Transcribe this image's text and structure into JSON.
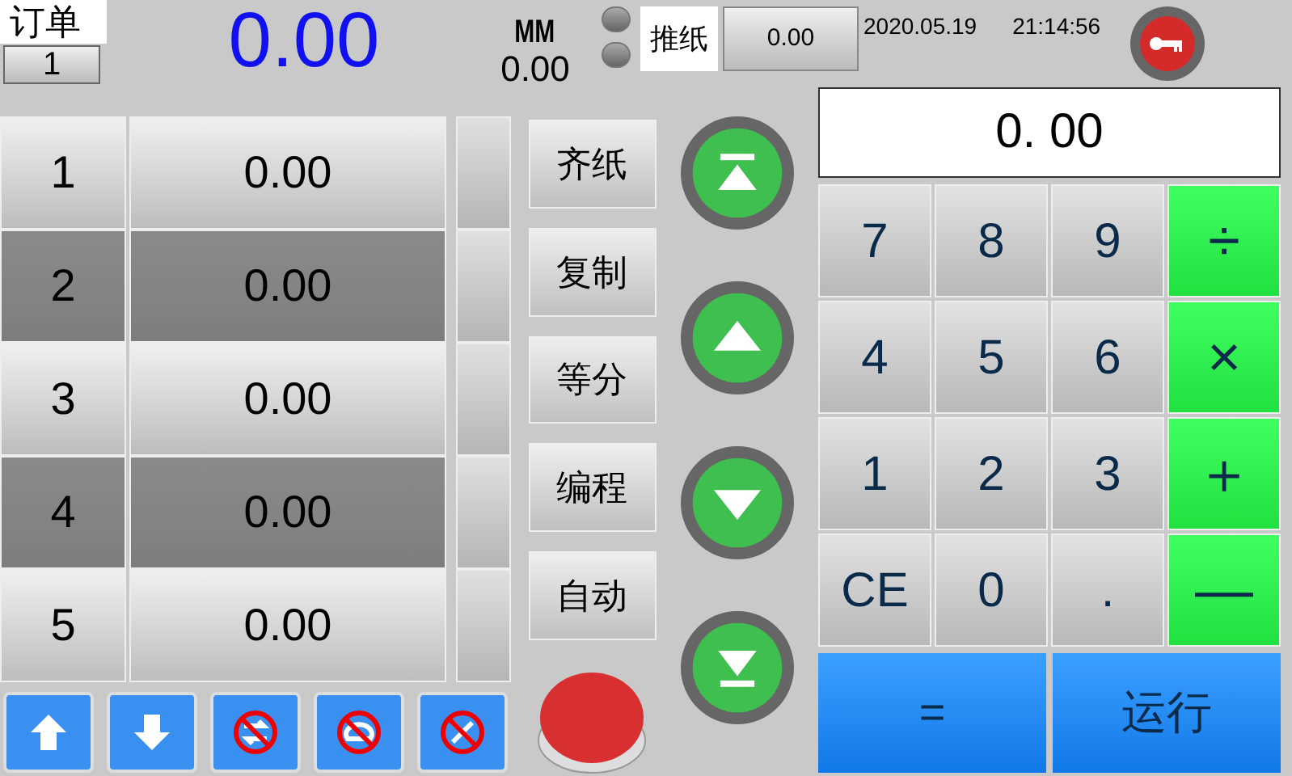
{
  "order": {
    "label": "订单",
    "value": "1"
  },
  "main_value": "0.00",
  "unit": "MM",
  "sub_value": "0.00",
  "lamps": [
    {
      "on": false
    },
    {
      "on": false
    }
  ],
  "push": {
    "label": "推纸",
    "value": "0.00"
  },
  "date": "2020.05.19",
  "time": "21:14:56",
  "rows": [
    {
      "index": "1",
      "value": "0.00",
      "selected": false
    },
    {
      "index": "2",
      "value": "0.00",
      "selected": true
    },
    {
      "index": "3",
      "value": "0.00",
      "selected": false
    },
    {
      "index": "4",
      "value": "0.00",
      "selected": true
    },
    {
      "index": "5",
      "value": "0.00",
      "selected": false
    }
  ],
  "function_buttons": [
    "齐纸",
    "复制",
    "等分",
    "编程",
    "自动"
  ],
  "jog_buttons": [
    {
      "kind": "top"
    },
    {
      "kind": "up"
    },
    {
      "kind": "down"
    },
    {
      "kind": "bottom"
    }
  ],
  "icon_buttons": [
    {
      "kind": "up",
      "disabled": false
    },
    {
      "kind": "down",
      "disabled": false
    },
    {
      "kind": "swap",
      "disabled": true
    },
    {
      "kind": "loop",
      "disabled": true
    },
    {
      "kind": "cross",
      "disabled": true
    }
  ],
  "display": "0. 00",
  "keys": [
    {
      "label": "7",
      "kind": "digit"
    },
    {
      "label": "8",
      "kind": "digit"
    },
    {
      "label": "9",
      "kind": "digit"
    },
    {
      "label": "÷",
      "kind": "op"
    },
    {
      "label": "4",
      "kind": "digit"
    },
    {
      "label": "5",
      "kind": "digit"
    },
    {
      "label": "6",
      "kind": "digit"
    },
    {
      "label": "×",
      "kind": "op"
    },
    {
      "label": "1",
      "kind": "digit"
    },
    {
      "label": "2",
      "kind": "digit"
    },
    {
      "label": "3",
      "kind": "digit"
    },
    {
      "label": "＋",
      "kind": "op"
    },
    {
      "label": "CE",
      "kind": "digit"
    },
    {
      "label": "0",
      "kind": "digit"
    },
    {
      "label": ".",
      "kind": "digit"
    },
    {
      "label": "—",
      "kind": "op"
    }
  ],
  "equals": "=",
  "run": "运行"
}
